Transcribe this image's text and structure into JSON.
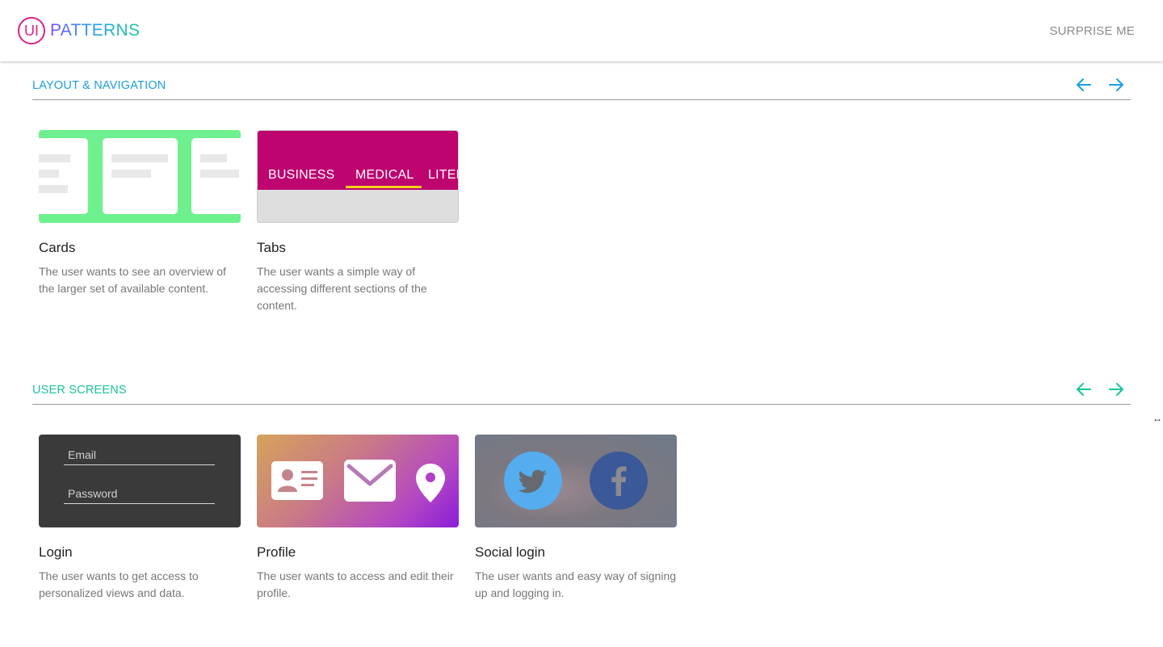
{
  "header": {
    "logo_mark": "UI",
    "logo_text": "PATTERNS",
    "surprise_label": "SURPRISE ME"
  },
  "colors": {
    "logo_ring": "#e0208c",
    "section1_accent": "#1a9fe0",
    "section2_accent": "#18c49a",
    "cards_thumb_bg": "#6ff08e",
    "tabs_thumb_bg": "#bd046f",
    "tabs_underline": "#f4d21a",
    "login_thumb_bg": "#3a3a3a",
    "twitter": "#55acee",
    "facebook": "#3b5998"
  },
  "sections": [
    {
      "title": "LAYOUT & NAVIGATION",
      "prev_icon": "arrow-left-icon",
      "next_icon": "arrow-right-icon",
      "cards": [
        {
          "title": "Cards",
          "description": "The user wants to see an overview of the larger set of available content."
        },
        {
          "title": "Tabs",
          "description": "The user wants a simple way of accessing different sections of the content.",
          "thumb_tabs": [
            "BUSINESS",
            "MEDICAL",
            "LITER"
          ],
          "thumb_active_tab": "MEDICAL"
        }
      ]
    },
    {
      "title": "USER SCREENS",
      "prev_icon": "arrow-left-icon",
      "next_icon": "arrow-right-icon",
      "cards": [
        {
          "title": "Login",
          "description": "The user wants to get access to personalized views and data.",
          "thumb_fields": [
            "Email",
            "Password"
          ]
        },
        {
          "title": "Profile",
          "description": "The user wants to access and edit their profile.",
          "thumb_icons": [
            "id-card-icon",
            "envelope-icon",
            "map-pin-icon"
          ]
        },
        {
          "title": "Social login",
          "description": "The user wants and easy way of signing up and logging in.",
          "thumb_icons": [
            "twitter-icon",
            "facebook-icon"
          ]
        }
      ]
    }
  ]
}
